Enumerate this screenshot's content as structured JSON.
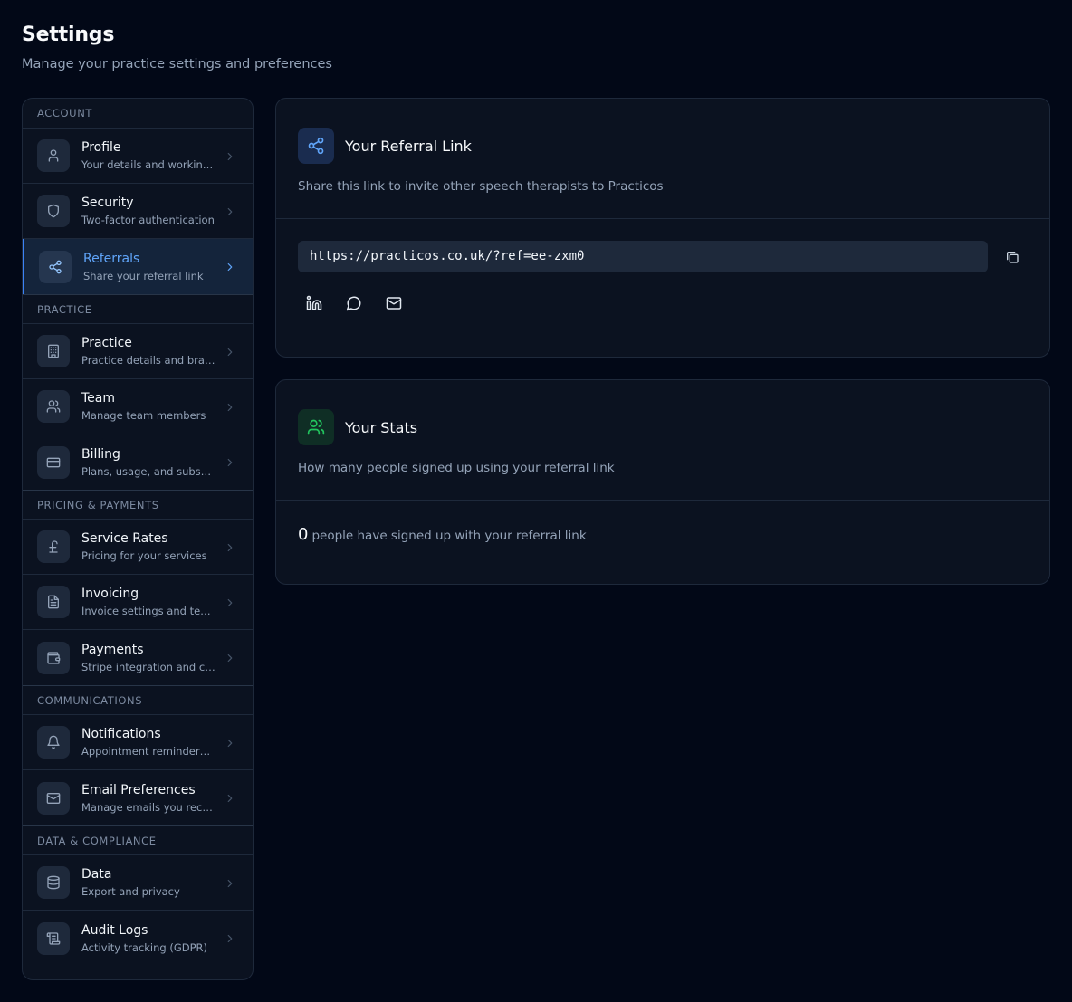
{
  "header": {
    "title": "Settings",
    "subtitle": "Manage your practice settings and preferences"
  },
  "sidebar": {
    "sections": [
      {
        "title": "ACCOUNT",
        "items": [
          {
            "label": "Profile",
            "desc": "Your details and working hours",
            "icon": "user-icon"
          },
          {
            "label": "Security",
            "desc": "Two-factor authentication",
            "icon": "shield-icon"
          },
          {
            "label": "Referrals",
            "desc": "Share your referral link",
            "icon": "share-icon",
            "active": true
          }
        ]
      },
      {
        "title": "PRACTICE",
        "items": [
          {
            "label": "Practice",
            "desc": "Practice details and branding",
            "icon": "building-icon"
          },
          {
            "label": "Team",
            "desc": "Manage team members",
            "icon": "users-icon"
          },
          {
            "label": "Billing",
            "desc": "Plans, usage, and subscription",
            "icon": "credit-card-icon"
          }
        ]
      },
      {
        "title": "PRICING & PAYMENTS",
        "items": [
          {
            "label": "Service Rates",
            "desc": "Pricing for your services",
            "icon": "pound-icon"
          },
          {
            "label": "Invoicing",
            "desc": "Invoice settings and templates",
            "icon": "file-text-icon"
          },
          {
            "label": "Payments",
            "desc": "Stripe integration and card payments",
            "icon": "wallet-icon"
          }
        ]
      },
      {
        "title": "COMMUNICATIONS",
        "items": [
          {
            "label": "Notifications",
            "desc": "Appointment reminders and alerts",
            "icon": "bell-icon"
          },
          {
            "label": "Email Preferences",
            "desc": "Manage emails you receive",
            "icon": "mail-icon"
          }
        ]
      },
      {
        "title": "DATA & COMPLIANCE",
        "items": [
          {
            "label": "Data",
            "desc": "Export and privacy",
            "icon": "database-icon"
          },
          {
            "label": "Audit Logs",
            "desc": "Activity tracking (GDPR)",
            "icon": "scroll-icon"
          }
        ]
      }
    ]
  },
  "referral_card": {
    "title": "Your Referral Link",
    "description": "Share this link to invite other speech therapists to Practicos",
    "link": "https://practicos.co.uk/?ref=ee-zxm0",
    "share_icons": [
      "linkedin-icon",
      "whatsapp-icon",
      "mail-icon"
    ]
  },
  "stats_card": {
    "title": "Your Stats",
    "description": "How many people signed up using your referral link",
    "count": "0",
    "count_text": "people have signed up with your referral link"
  },
  "colors": {
    "background": "#020817",
    "card": "#0b1220",
    "border": "#1e293b",
    "accent": "#3b82f6",
    "success": "#22c55e"
  }
}
